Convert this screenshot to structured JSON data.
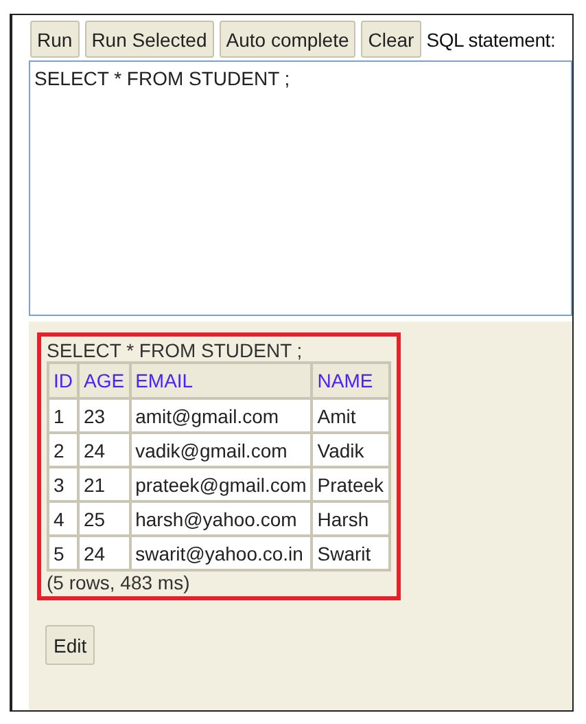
{
  "toolbar": {
    "buttons": [
      "Run",
      "Run Selected",
      "Auto complete",
      "Clear"
    ],
    "label": "SQL statement:"
  },
  "editor": {
    "value": "SELECT * FROM STUDENT ;"
  },
  "result": {
    "query": "SELECT * FROM STUDENT ;",
    "table": {
      "columns": [
        "ID",
        "AGE",
        "EMAIL",
        "NAME"
      ],
      "rows": [
        [
          "1",
          "23",
          "amit@gmail.com",
          "Amit"
        ],
        [
          "2",
          "24",
          "vadik@gmail.com",
          "Vadik"
        ],
        [
          "3",
          "21",
          "prateek@gmail.com",
          "Prateek"
        ],
        [
          "4",
          "25",
          "harsh@yahoo.com",
          "Harsh"
        ],
        [
          "5",
          "24",
          "swarit@yahoo.co.in",
          "Swarit"
        ]
      ]
    },
    "summary": "(5 rows, 483 ms)"
  },
  "buttons": [
    "Edit"
  ]
}
